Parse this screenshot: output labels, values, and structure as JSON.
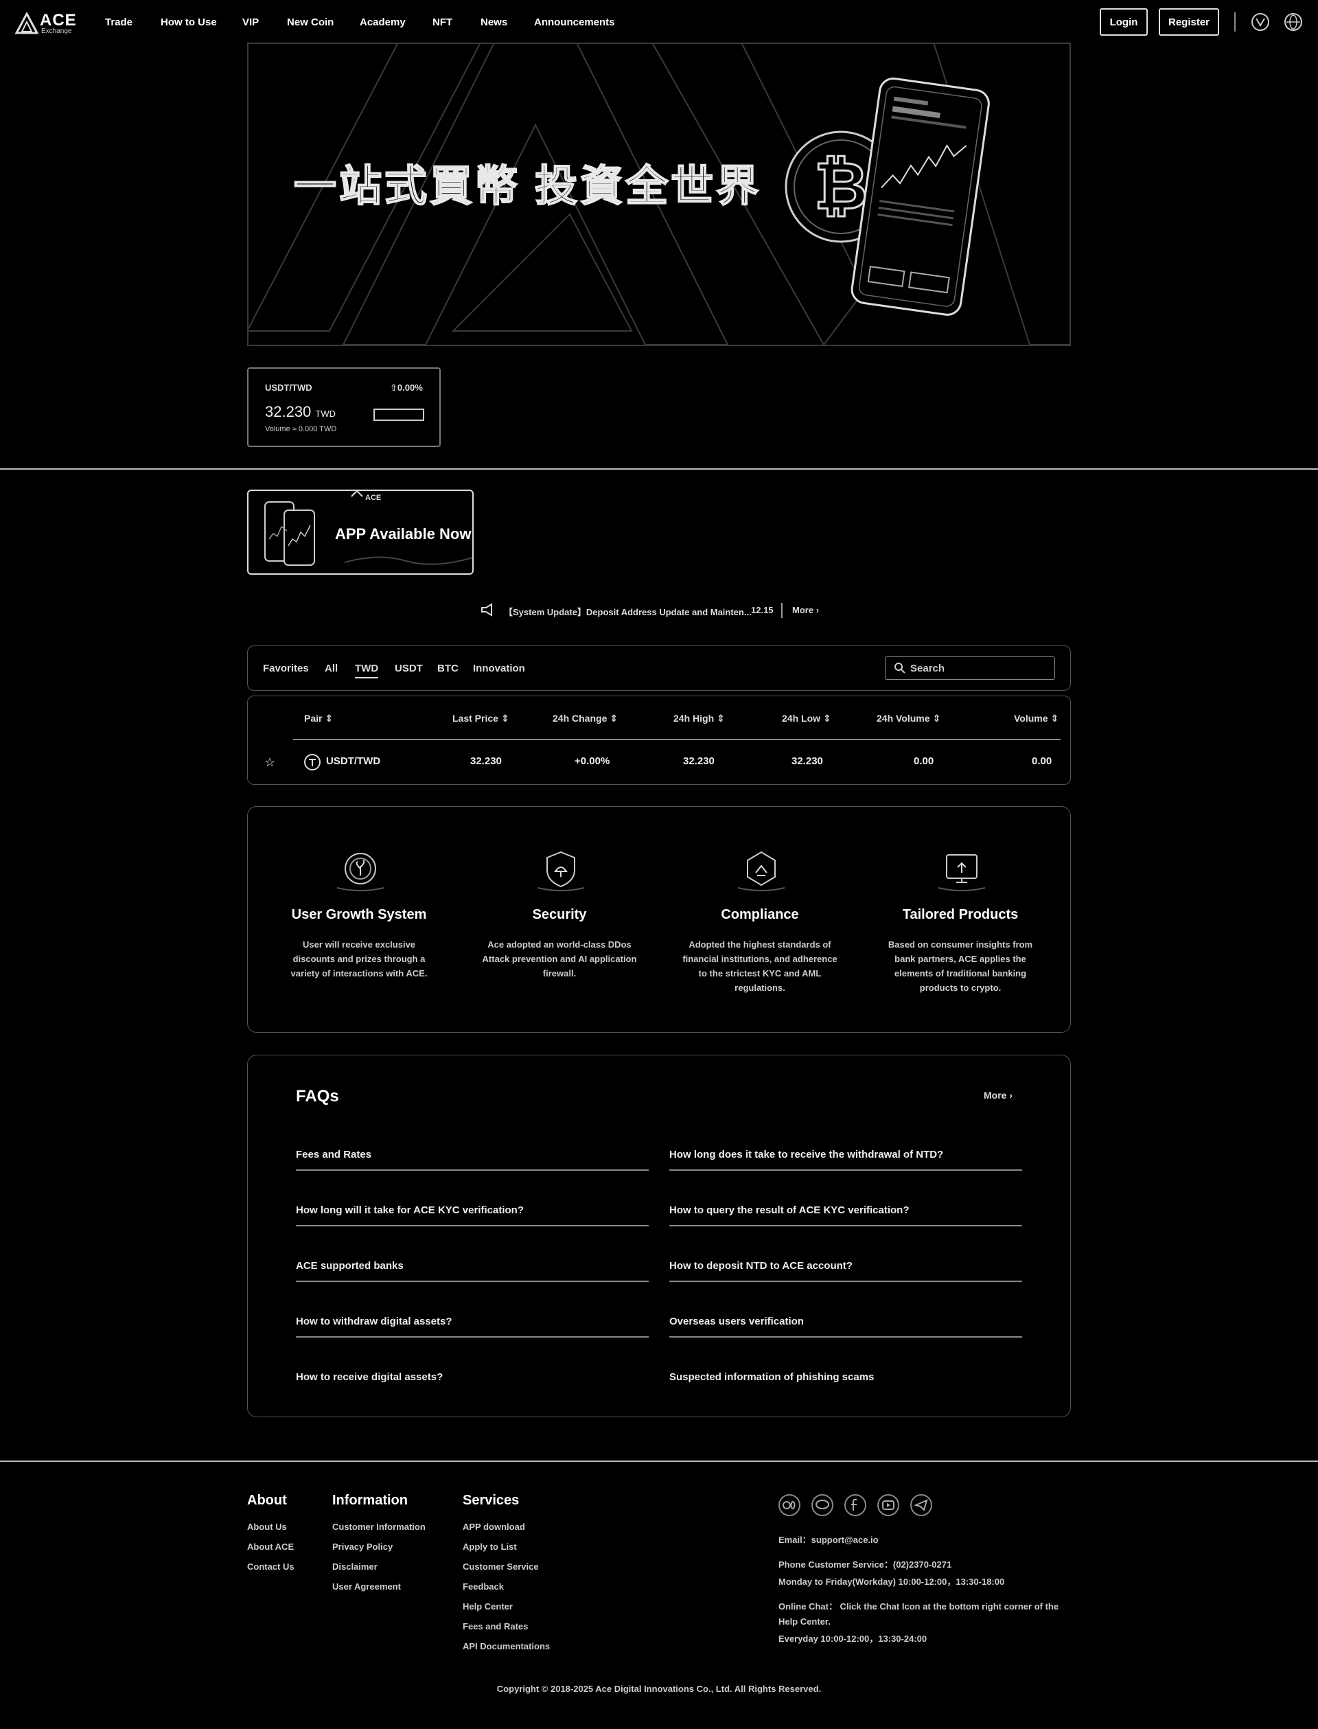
{
  "header": {
    "logo_text": "ACE",
    "logo_sub": "Exchange",
    "nav": [
      "Trade",
      "How to Use",
      "VIP",
      "New Coin",
      "Academy",
      "NFT",
      "News",
      "Announcements"
    ],
    "login_label": "Login",
    "register_label": "Register"
  },
  "banner": {
    "title": "一站式買幣 投資全世界"
  },
  "ticker": {
    "pair": "USDT/TWD",
    "change": "0.00%",
    "price": "32.230",
    "unit": "TWD",
    "volume": "Volume ≈ 0.000 TWD"
  },
  "app_banner": {
    "logo_text": "ACE",
    "text": "APP Available Now"
  },
  "announcement": {
    "text": "【System Update】Deposit Address Update and Mainten...",
    "date": "12.15",
    "more": "More"
  },
  "market": {
    "tabs": [
      "Favorites",
      "All",
      "TWD",
      "USDT",
      "BTC",
      "Innovation"
    ],
    "active_tab": "TWD",
    "search_placeholder": "Search",
    "columns": [
      "Pair",
      "Last Price",
      "24h Change",
      "24h High",
      "24h Low",
      "24h Volume",
      "Volume"
    ],
    "rows": [
      {
        "pair": "USDT/TWD",
        "last_price": "32.230",
        "change": "+0.00%",
        "high": "32.230",
        "low": "32.230",
        "volume_24h": "0.00",
        "volume": "0.00"
      }
    ]
  },
  "features": [
    {
      "title": "User Growth System",
      "desc": "User will receive exclusive discounts and prizes through a variety of interactions with ACE."
    },
    {
      "title": "Security",
      "desc": "Ace adopted an world-class DDos Attack prevention and AI application firewall."
    },
    {
      "title": "Compliance",
      "desc": "Adopted the highest standards of financial institutions, and adherence to the strictest KYC and AML regulations."
    },
    {
      "title": "Tailored Products",
      "desc": "Based on consumer insights from bank partners, ACE applies the elements of traditional banking products to crypto."
    }
  ],
  "faq": {
    "title": "FAQs",
    "more": "More",
    "left": [
      "Fees and Rates",
      "How long will it take for ACE KYC verification?",
      "ACE supported banks",
      "How to withdraw digital assets?",
      "How to receive digital assets?"
    ],
    "right": [
      "How long does it take to receive the withdrawal of NTD?",
      "How to query the result of ACE KYC verification?",
      "How to deposit NTD to ACE account?",
      "Overseas users verification",
      "Suspected information of phishing scams"
    ]
  },
  "footer": {
    "about": {
      "title": "About",
      "links": [
        "About Us",
        "About ACE",
        "Contact Us"
      ]
    },
    "information": {
      "title": "Information",
      "links": [
        "Customer Information",
        "Privacy Policy",
        "Disclaimer",
        "User Agreement"
      ]
    },
    "services": {
      "title": "Services",
      "links": [
        "APP download",
        "Apply to List",
        "Customer Service",
        "Feedback",
        "Help Center",
        "Fees and Rates",
        "API Documentations"
      ]
    },
    "social_icons": [
      "medium-icon",
      "line-icon",
      "facebook-icon",
      "youtube-icon",
      "telegram-icon"
    ],
    "email": "Email：support@ace.io",
    "phone": "Phone Customer Service：(02)2370-0271",
    "phone_hours": "Monday to Friday(Workday) 10:00-12:00，13:30-18:00",
    "chat": "Online Chat： Click the Chat Icon at the bottom right corner of the Help Center.",
    "chat_hours": "Everyday 10:00-12:00，13:30-24:00",
    "copyright": "Copyright © 2018-2025 Ace Digital Innovations Co., Ltd. All Rights Reserved."
  }
}
